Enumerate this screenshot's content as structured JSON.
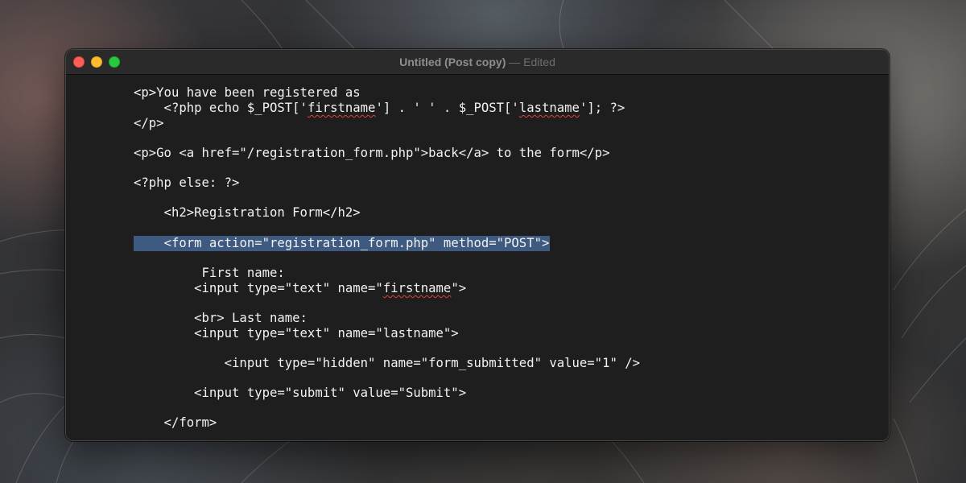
{
  "window": {
    "title": "Untitled (Post copy)",
    "separator": "—",
    "status": "Edited"
  },
  "colors": {
    "close": "#ff5f57",
    "minimize": "#febc2e",
    "zoom": "#28c840",
    "editor_background": "#1e1e1e",
    "text": "#f2f2f2",
    "selection": "#3e5a80",
    "spelling_underline": "#e0433a"
  },
  "editor": {
    "line1": "<p>You have been registered as",
    "line2_a": "    <?php echo $_POST['",
    "line2_b": "firstname",
    "line2_c": "'] . ' ' . $_POST['",
    "line2_d": "lastname",
    "line2_e": "']; ?>",
    "line3": "</p>",
    "line4": "<p>Go <a href=\"/registration_form.php\">back</a> to the form</p>",
    "line5": "<?php else: ?>",
    "line6": "    <h2>Registration Form</h2>",
    "line7_indent": "    ",
    "line7": "<form action=\"registration_form.php\" method=\"POST\">",
    "line8": "         First name:",
    "line9_a": "        <input type=\"text\" name=\"",
    "line9_b": "firstname",
    "line9_c": "\">",
    "line10": "        <br> Last name:",
    "line11": "        <input type=\"text\" name=\"lastname\">",
    "line12": "            <input type=\"hidden\" name=\"form_submitted\" value=\"1\" />",
    "line13": "        <input type=\"submit\" value=\"Submit\">",
    "line14": "    </form>"
  }
}
